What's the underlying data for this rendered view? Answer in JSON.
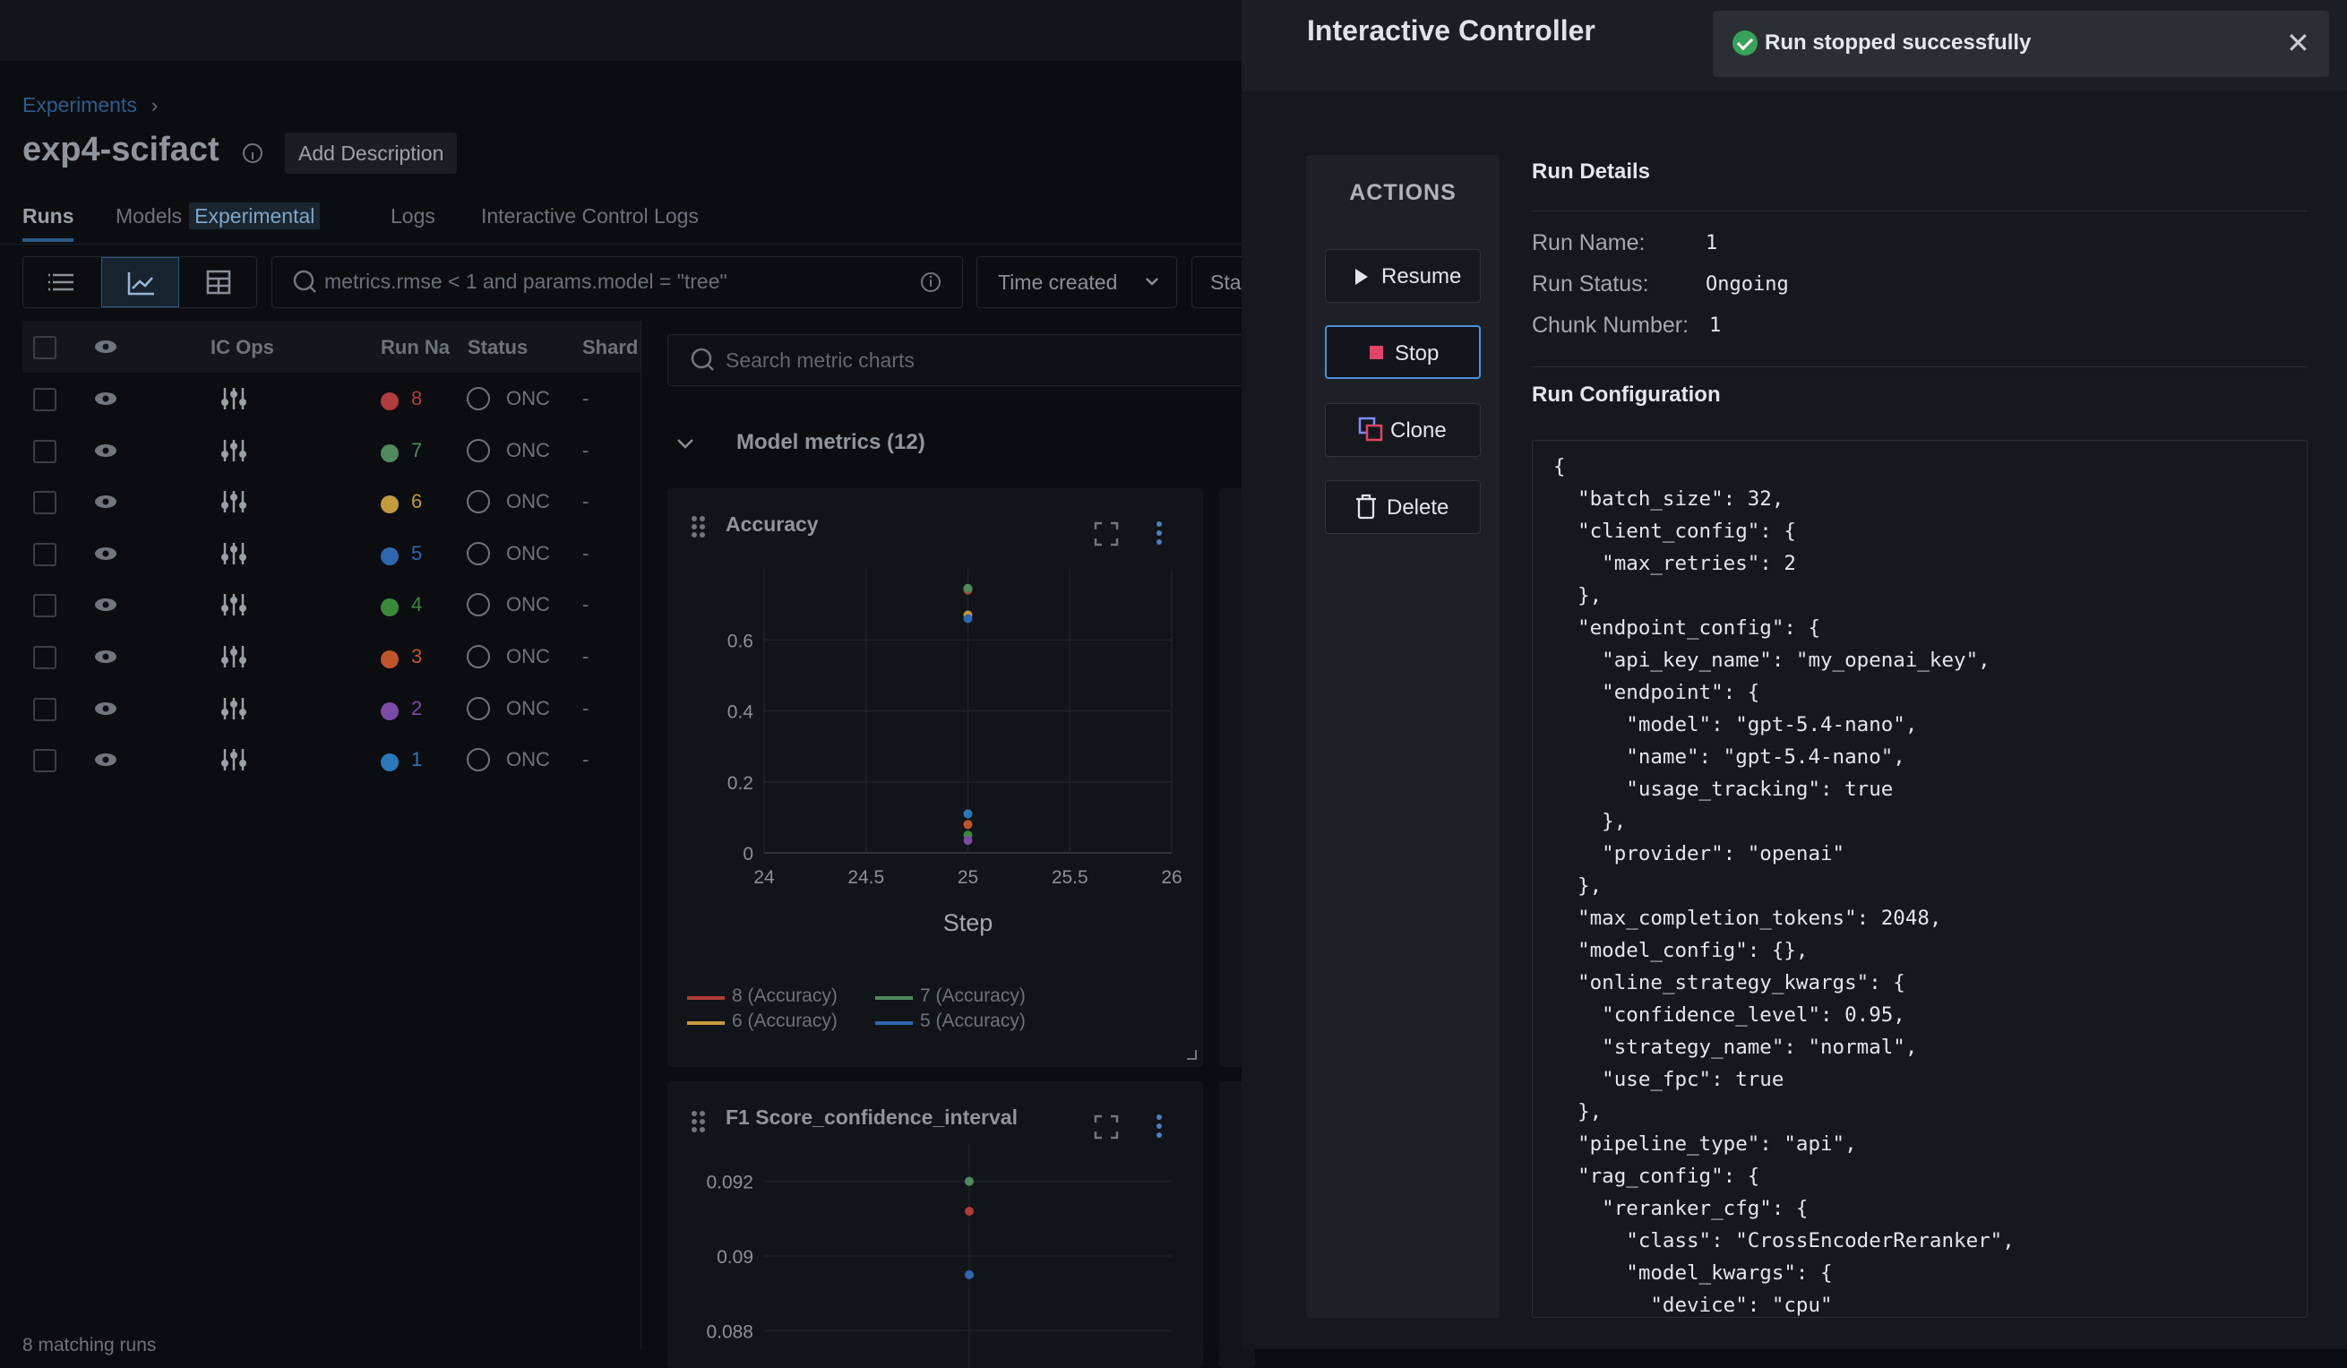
{
  "breadcrumb": {
    "label": "Experiments",
    "sep": "›"
  },
  "experiment": {
    "title": "exp4-scifact",
    "add_description": "Add Description"
  },
  "tabs": [
    {
      "label": "Runs"
    },
    {
      "label": "Models",
      "badge": "Experimental"
    },
    {
      "label": "Logs"
    },
    {
      "label": "Interactive Control Logs"
    }
  ],
  "search": {
    "query": "metrics.rmse < 1 and params.model = \"tree\""
  },
  "sort": {
    "label": "Time created"
  },
  "state": {
    "label": "Sta"
  },
  "table": {
    "headers": {
      "ic_ops": "IC Ops",
      "run_name": "Run Na",
      "status": "Status",
      "shard": "Shard"
    },
    "rows": [
      {
        "run": "8",
        "status": "ONC",
        "shard": "-",
        "color": "#b23b3b"
      },
      {
        "run": "7",
        "status": "ONC",
        "shard": "-",
        "color": "#4f8a5e"
      },
      {
        "run": "6",
        "status": "ONC",
        "shard": "-",
        "color": "#c59a3a"
      },
      {
        "run": "5",
        "status": "ONC",
        "shard": "-",
        "color": "#2f66b0"
      },
      {
        "run": "4",
        "status": "ONC",
        "shard": "-",
        "color": "#3b8a3b"
      },
      {
        "run": "3",
        "status": "ONC",
        "shard": "-",
        "color": "#c0552c"
      },
      {
        "run": "2",
        "status": "ONC",
        "shard": "-",
        "color": "#7c4aa8"
      },
      {
        "run": "1",
        "status": "ONC",
        "shard": "-",
        "color": "#2a78b8"
      }
    ],
    "matching": "8 matching runs"
  },
  "metrics": {
    "search_placeholder": "Search metric charts",
    "section_title": "Model metrics (12)"
  },
  "chart_data": [
    {
      "type": "scatter",
      "title": "Accuracy",
      "xlabel": "Step",
      "xlim": [
        24,
        26
      ],
      "ylim": [
        0,
        0.8
      ],
      "x_ticks": [
        "24",
        "24.5",
        "25",
        "25.5",
        "26"
      ],
      "y_ticks": [
        "0",
        "0.2",
        "0.4",
        "0.6"
      ],
      "series": [
        {
          "name": "8 (Accuracy)",
          "color": "#b23b3b",
          "x": [
            25
          ],
          "y": [
            0.74
          ]
        },
        {
          "name": "7 (Accuracy)",
          "color": "#4f8a5e",
          "x": [
            25
          ],
          "y": [
            0.745
          ]
        },
        {
          "name": "6 (Accuracy)",
          "color": "#c59a3a",
          "x": [
            25
          ],
          "y": [
            0.67
          ]
        },
        {
          "name": "5 (Accuracy)",
          "color": "#2f66b0",
          "x": [
            25
          ],
          "y": [
            0.66
          ]
        },
        {
          "color": "#2a78b8",
          "x": [
            25
          ],
          "y": [
            0.11
          ]
        },
        {
          "color": "#c0552c",
          "x": [
            25
          ],
          "y": [
            0.08
          ]
        },
        {
          "color": "#3b8a3b",
          "x": [
            25
          ],
          "y": [
            0.05
          ]
        },
        {
          "color": "#7c4aa8",
          "x": [
            25
          ],
          "y": [
            0.035
          ]
        }
      ]
    },
    {
      "type": "scatter",
      "title": "F1 Score_confidence_interval",
      "ylim": [
        0.087,
        0.093
      ],
      "y_ticks": [
        "0.092",
        "0.09",
        "0.088"
      ],
      "series": [
        {
          "color": "#4f8a5e",
          "x": [
            25
          ],
          "y": [
            0.092
          ]
        },
        {
          "color": "#b23b3b",
          "x": [
            25
          ],
          "y": [
            0.0912
          ]
        },
        {
          "color": "#2f66b0",
          "x": [
            25
          ],
          "y": [
            0.0895
          ]
        }
      ]
    }
  ],
  "panel": {
    "title": "Interactive Controller",
    "toast": "Run stopped successfully",
    "actions_header": "ACTIONS",
    "buttons": {
      "resume": "Resume",
      "stop": "Stop",
      "clone": "Clone",
      "delete": "Delete"
    },
    "run_details_header": "Run Details",
    "run_name_label": "Run Name:",
    "run_name": "1",
    "run_status_label": "Run Status:",
    "run_status": "Ongoing",
    "chunk_label": "Chunk Number:",
    "chunk": "1",
    "config_header": "Run Configuration",
    "config_text": "{\n  \"batch_size\": 32,\n  \"client_config\": {\n    \"max_retries\": 2\n  },\n  \"endpoint_config\": {\n    \"api_key_name\": \"my_openai_key\",\n    \"endpoint\": {\n      \"model\": \"gpt-5.4-nano\",\n      \"name\": \"gpt-5.4-nano\",\n      \"usage_tracking\": true\n    },\n    \"provider\": \"openai\"\n  },\n  \"max_completion_tokens\": 2048,\n  \"model_config\": {},\n  \"online_strategy_kwargs\": {\n    \"confidence_level\": 0.95,\n    \"strategy_name\": \"normal\",\n    \"use_fpc\": true\n  },\n  \"pipeline_type\": \"api\",\n  \"rag_config\": {\n    \"reranker_cfg\": {\n      \"class\": \"CrossEncoderReranker\",\n      \"model_kwargs\": {\n        \"device\": \"cpu\""
  }
}
